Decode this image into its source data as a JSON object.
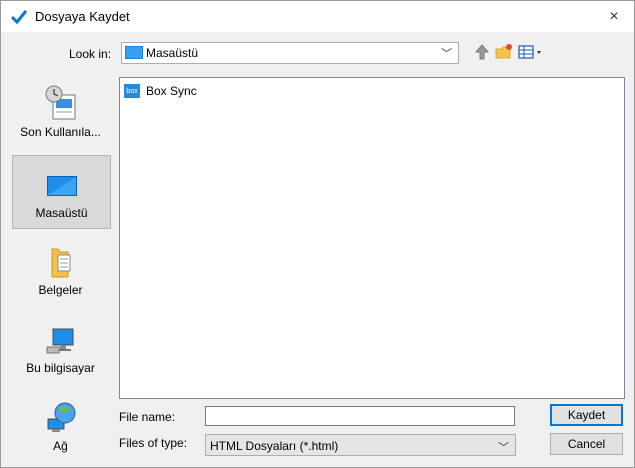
{
  "window": {
    "title": "Dosyaya Kaydet",
    "close_glyph": "×"
  },
  "lookin": {
    "label": "Look in:",
    "value": "Masaüstü"
  },
  "toolbar": {
    "icons": [
      "up-folder-icon",
      "new-folder-icon",
      "view-menu-icon"
    ]
  },
  "places": [
    {
      "label": "Son Kullanıla...",
      "icon": "recent-places-icon",
      "selected": false
    },
    {
      "label": "Masaüstü",
      "icon": "desktop-icon",
      "selected": true
    },
    {
      "label": "Belgeler",
      "icon": "documents-folder-icon",
      "selected": false
    },
    {
      "label": "Bu bilgisayar",
      "icon": "computer-icon",
      "selected": false
    },
    {
      "label": "Ağ",
      "icon": "network-globe-icon",
      "selected": false
    }
  ],
  "files": [
    {
      "name": "Box Sync",
      "icon": "box-sync-icon",
      "logo_text": "box"
    }
  ],
  "filename": {
    "label": "File name:",
    "value": ""
  },
  "filetype": {
    "label": "Files of type:",
    "value": "HTML Dosyaları (*.html)"
  },
  "buttons": {
    "save": "Kaydet",
    "cancel": "Cancel"
  },
  "colors": {
    "accent": "#0078d7",
    "box_brand": "#2a88d8"
  }
}
